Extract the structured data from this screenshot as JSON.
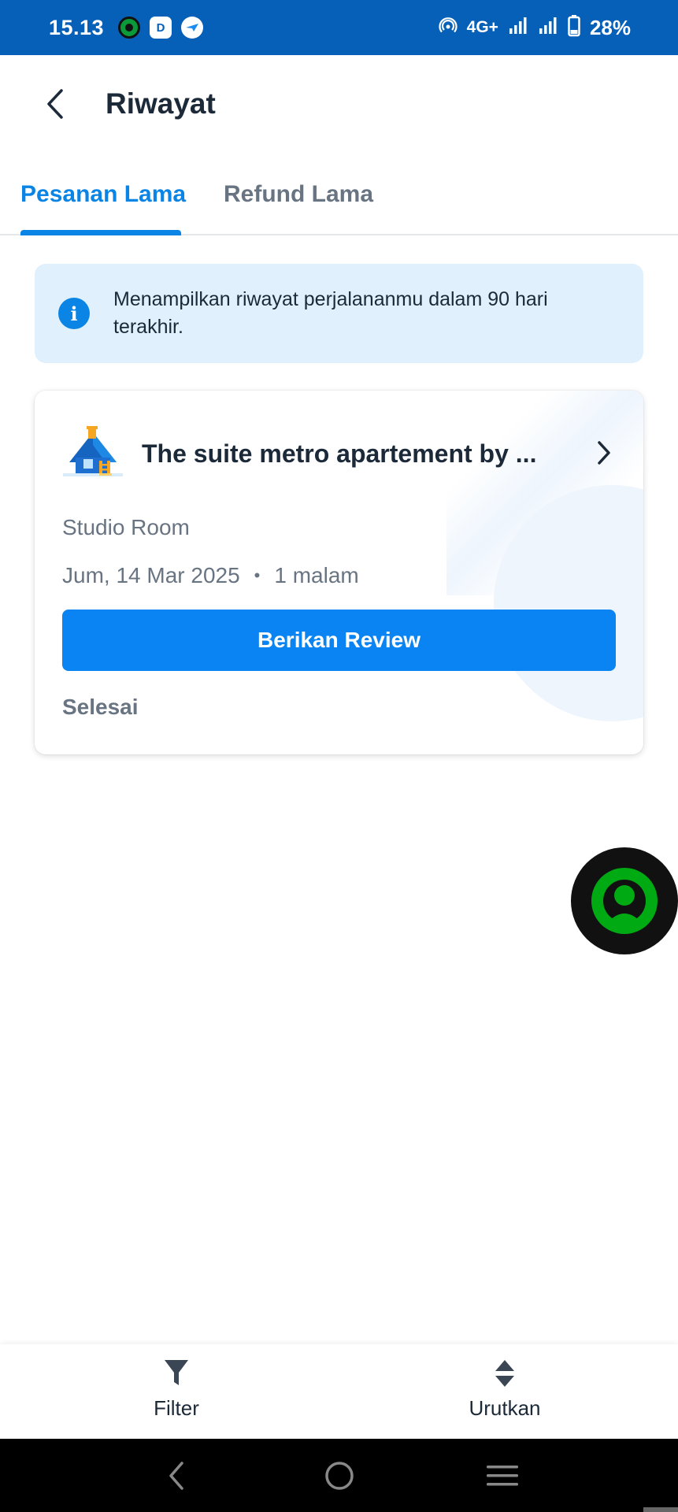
{
  "status_bar": {
    "time": "15.13",
    "network": "4G+",
    "battery": "28%",
    "icons": [
      "gojek-icon",
      "dana-icon",
      "traveloka-icon",
      "hotspot-icon",
      "signal-icon",
      "battery-icon"
    ]
  },
  "header": {
    "title": "Riwayat",
    "back_icon": "chevron-left-icon"
  },
  "tabs": [
    {
      "label": "Pesanan Lama",
      "active": true
    },
    {
      "label": "Refund Lama",
      "active": false
    }
  ],
  "info_banner": {
    "icon": "info-icon",
    "text": "Menampilkan riwayat perjalananmu dalam 90 hari terakhir."
  },
  "booking_card": {
    "title": "The suite metro apartement by ...",
    "room": "Studio Room",
    "date": "Jum, 14 Mar 2025",
    "separator": "•",
    "duration": "1 malam",
    "review_button": "Berikan Review",
    "status": "Selesai"
  },
  "bottom_bar": {
    "filter_label": "Filter",
    "sort_label": "Urutkan"
  },
  "colors": {
    "primary": "#0a84f2",
    "status_bar": "#0760b8",
    "info_bg": "#e0f0fd",
    "text_dark": "#1c2939",
    "text_muted": "#687482"
  }
}
